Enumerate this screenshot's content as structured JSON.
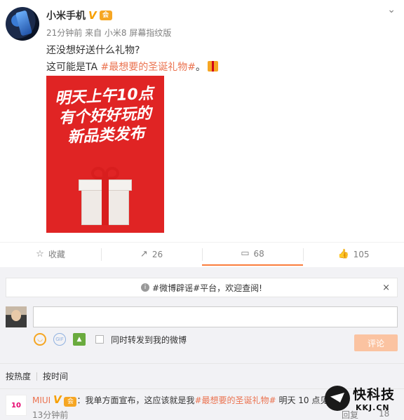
{
  "post": {
    "author": "小米手机",
    "verified_mark": "V",
    "vip_mark": "会",
    "meta": "21分钟前 来自 小米8 屏幕指纹版",
    "line1": "还没想好送什么礼物?",
    "line2_prefix": "这可能是TA ",
    "line2_topic": "#最想要的圣诞礼物#",
    "line2_suffix": "。",
    "poster_text": [
      "明天上午10点",
      "有个好好玩的",
      "新品类发布"
    ]
  },
  "actions": [
    {
      "icon": "star-icon",
      "glyph": "☆",
      "label": "收藏"
    },
    {
      "icon": "forward-icon",
      "glyph": "↗",
      "label": "26"
    },
    {
      "icon": "comment-icon",
      "glyph": "▭",
      "label": "68"
    },
    {
      "icon": "like-icon",
      "glyph": "👍",
      "label": "105"
    }
  ],
  "notice": {
    "text": "#微博辟谣#平台，欢迎查阅!",
    "close": "×"
  },
  "composer": {
    "forward_label": "同时转发到我的微博",
    "submit_label": "评论",
    "gif_label": "GIF"
  },
  "sort": {
    "hot": "按热度",
    "time": "按时间"
  },
  "comment": {
    "avatar_text": "10",
    "name": "MIUI",
    "verified_mark": "V",
    "prefix": "：我单方面宣布，这应该就是我",
    "topic": "#最想要的圣诞礼物#",
    "suffix": " 明天 10 点见",
    "time": "13分钟前",
    "reply": "回复",
    "likes": "18"
  },
  "watermark": {
    "title": "快科技",
    "sub": "KKJ.CN"
  },
  "colors": {
    "accent": "#eb7350",
    "poster_red": "#e02424",
    "button_disabled": "#fbc3a1"
  }
}
